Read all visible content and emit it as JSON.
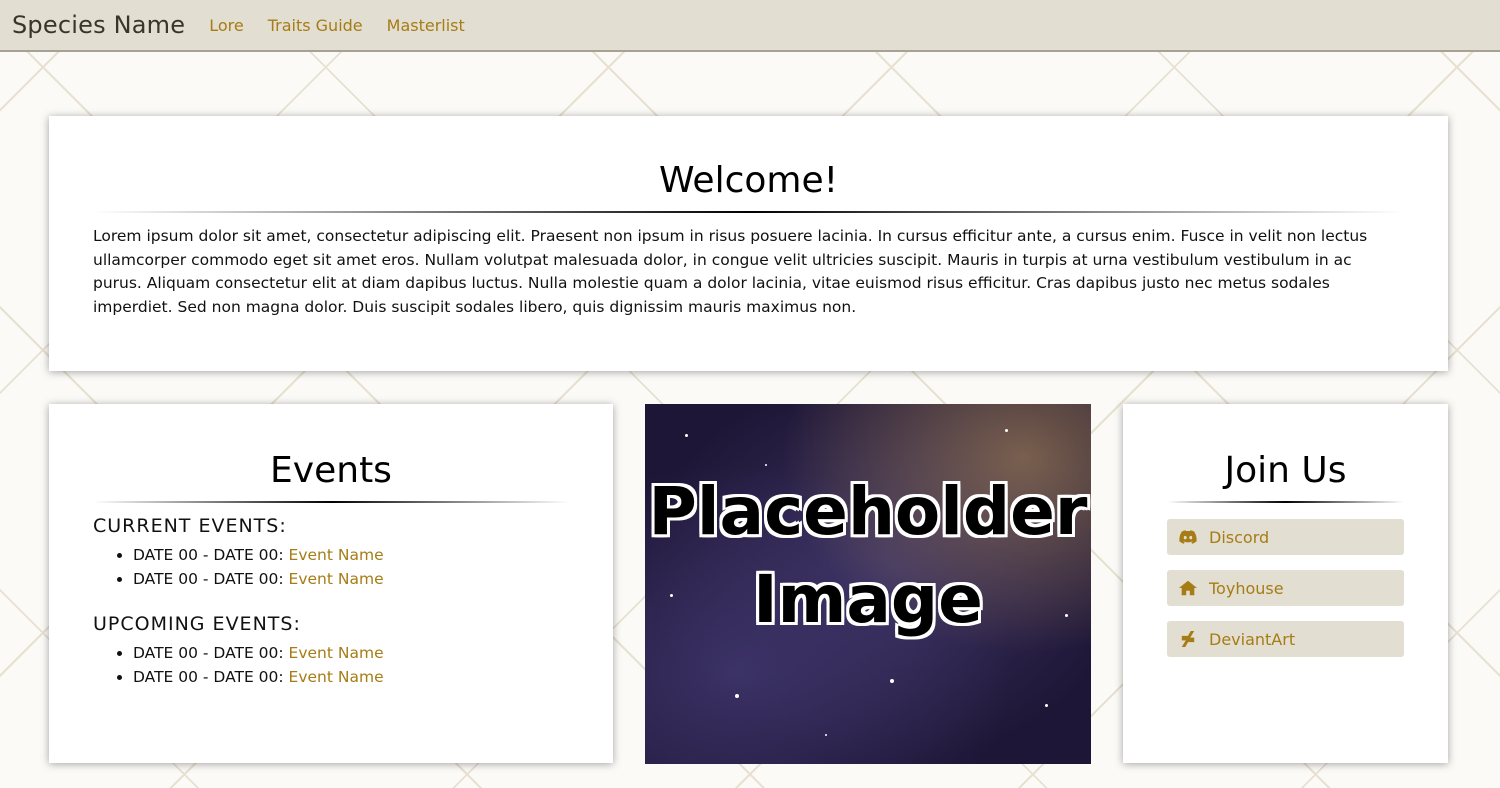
{
  "nav": {
    "brand": "Species Name",
    "links": [
      {
        "label": "Lore"
      },
      {
        "label": "Traits Guide"
      },
      {
        "label": "Masterlist"
      }
    ]
  },
  "welcome": {
    "title": "Welcome!",
    "text": "Lorem ipsum dolor sit amet, consectetur adipiscing elit. Praesent non ipsum in risus posuere lacinia. In cursus efficitur ante, a cursus enim. Fusce in velit non lectus ullamcorper commodo eget sit amet eros. Nullam volutpat malesuada dolor, in congue velit ultricies suscipit. Mauris in turpis at urna vestibulum vestibulum in ac purus. Aliquam consectetur elit at diam dapibus luctus. Nulla molestie quam a dolor lacinia, vitae euismod risus efficitur. Cras dapibus justo nec metus sodales imperdiet. Sed non magna dolor. Duis suscipit sodales libero, quis dignissim mauris maximus non."
  },
  "events": {
    "title": "Events",
    "current_title": "CURRENT EVENTS:",
    "current": [
      {
        "dates": "DATE 00 - DATE 00: ",
        "name": "Event Name"
      },
      {
        "dates": "DATE 00 - DATE 00: ",
        "name": "Event Name"
      }
    ],
    "upcoming_title": "UPCOMING EVENTS:",
    "upcoming": [
      {
        "dates": "DATE 00 - DATE 00: ",
        "name": "Event Name"
      },
      {
        "dates": "DATE 00 - DATE 00: ",
        "name": "Event Name"
      }
    ]
  },
  "image": {
    "line1": "Placeholder",
    "line2": "Image"
  },
  "join": {
    "title": "Join Us",
    "buttons": [
      {
        "label": "Discord",
        "icon": "discord-icon"
      },
      {
        "label": "Toyhouse",
        "icon": "home-icon"
      },
      {
        "label": "DeviantArt",
        "icon": "deviantart-icon"
      }
    ]
  },
  "colors": {
    "accent": "#a67c14",
    "nav_bg": "#e3ded2",
    "button_bg": "#e3ded2"
  }
}
